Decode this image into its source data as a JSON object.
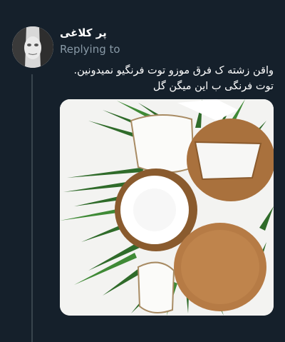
{
  "tweet": {
    "author_name": "پر کلاغی",
    "replying_to": "Replying to",
    "text_lines": [
      "واقن زشته ک فرق موزو توت فرنگیو نمیدونین.",
      "توت فرنگی ب این میگن گل"
    ]
  },
  "media": {
    "icon": "coconut-photo"
  },
  "colors": {
    "background": "#15202b",
    "secondary_text": "#8899a6",
    "thread_line": "#38444d"
  }
}
